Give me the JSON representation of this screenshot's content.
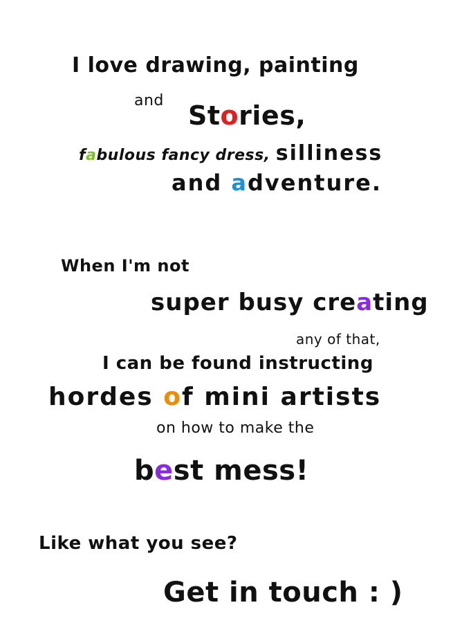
{
  "colors": {
    "text": "#111111",
    "accent_green": "#7bc21c",
    "accent_red": "#e02020",
    "accent_blue": "#1f8fd6",
    "accent_purple": "#8a2be2",
    "accent_orange": "#f08a00",
    "accent_yellow": "#f3c300",
    "background": "#ffffff"
  },
  "intro": {
    "line1": "I love drawing, painting",
    "line2": "and",
    "line3_before": "St",
    "line3_accent": "o",
    "line3_after": "ries,",
    "line4_before": "f",
    "line4_accent": "a",
    "line4_after": "bulous fancy dress,",
    "line4_emph": "silliness",
    "line5_before": "and ",
    "line5_accent": "a",
    "line5_after": "dventure."
  },
  "middle": {
    "line1": "When I'm not",
    "line2_before": "super busy cre",
    "line2_accent": "a",
    "line2_after": "ting",
    "line3": "any of that,",
    "line4": "I can be found instructing",
    "line5_before": "hordes ",
    "line5_accent": "o",
    "line5_after": "f mini artists",
    "line6": "on how to make the",
    "line7_before": "b",
    "line7_accent": "e",
    "line7_after": "st mess!"
  },
  "outro": {
    "line1": "Like what you see?",
    "line2": "Get in touch : )"
  }
}
